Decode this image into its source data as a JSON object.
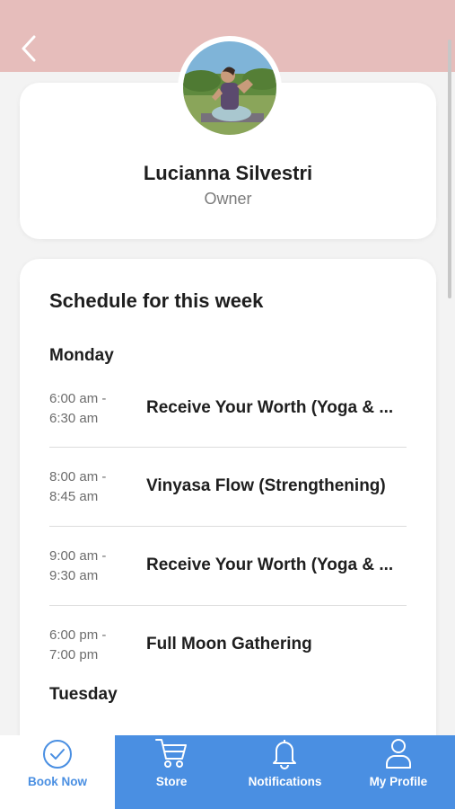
{
  "profile": {
    "name": "Lucianna Silvestri",
    "role": "Owner"
  },
  "schedule": {
    "title": "Schedule for this week",
    "days": [
      {
        "label": "Monday",
        "classes": [
          {
            "time_start": "6:00 am -",
            "time_end": "6:30 am",
            "name": "Receive Your Worth (Yoga & ..."
          },
          {
            "time_start": "8:00 am -",
            "time_end": "8:45 am",
            "name": "Vinyasa Flow (Strengthening)"
          },
          {
            "time_start": "9:00 am -",
            "time_end": "9:30 am",
            "name": "Receive Your Worth (Yoga & ..."
          },
          {
            "time_start": "6:00 pm -",
            "time_end": "7:00 pm",
            "name": "Full Moon Gathering"
          }
        ]
      },
      {
        "label": "Tuesday",
        "classes": []
      }
    ]
  },
  "tabs": [
    {
      "label": "Book Now",
      "icon": "check-circle-icon",
      "active": true
    },
    {
      "label": "Store",
      "icon": "cart-icon",
      "active": false
    },
    {
      "label": "Notifications",
      "icon": "bell-icon",
      "active": false
    },
    {
      "label": "My Profile",
      "icon": "person-icon",
      "active": false
    }
  ],
  "colors": {
    "header": "#e6bdbb",
    "accent": "#4a8fe2",
    "background": "#f3f3f3"
  }
}
